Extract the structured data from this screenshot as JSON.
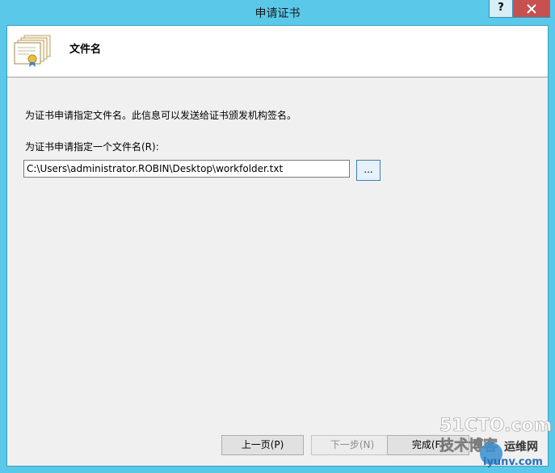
{
  "window": {
    "title": "申请证书",
    "help_label": "?",
    "close_label": "X"
  },
  "header": {
    "title": "文件名",
    "icon": "certificate-icon"
  },
  "content": {
    "description": "为证书申请指定文件名。此信息可以发送给证书颁发机构签名。",
    "field_label": "为证书申请指定一个文件名(R):",
    "path_value": "C:\\Users\\administrator.ROBIN\\Desktop\\workfolder.txt",
    "browse_label": "..."
  },
  "footer": {
    "back_label": "上一页(P)",
    "next_label": "下一步(N)",
    "finish_label": "完成(F)"
  },
  "watermark": {
    "line1": "51CTO.com",
    "line2": "技术博客",
    "line3": "运维网",
    "line4": "iyunv.com"
  },
  "colors": {
    "titlebar": "#5ac8e8",
    "close_button": "#c75050",
    "client_bg": "#f0f0f0"
  }
}
